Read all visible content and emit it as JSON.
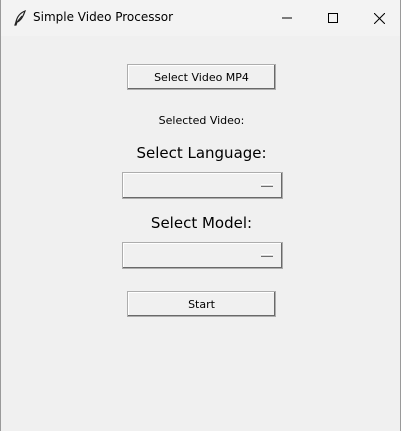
{
  "window": {
    "title": "Simple Video Processor",
    "icon": "feather-icon",
    "controls": {
      "minimize": "minimize-icon",
      "maximize": "maximize-icon",
      "close": "close-icon"
    }
  },
  "main": {
    "select_video_button": "Select Video MP4",
    "selected_video_label": "Selected Video:",
    "language_label": "Select Language:",
    "language_value": "",
    "model_label": "Select Model:",
    "model_value": "",
    "start_button": "Start"
  },
  "colors": {
    "window_bg": "#f0f0f0",
    "titlebar_bg": "#f3f3f3",
    "text": "#000000"
  }
}
